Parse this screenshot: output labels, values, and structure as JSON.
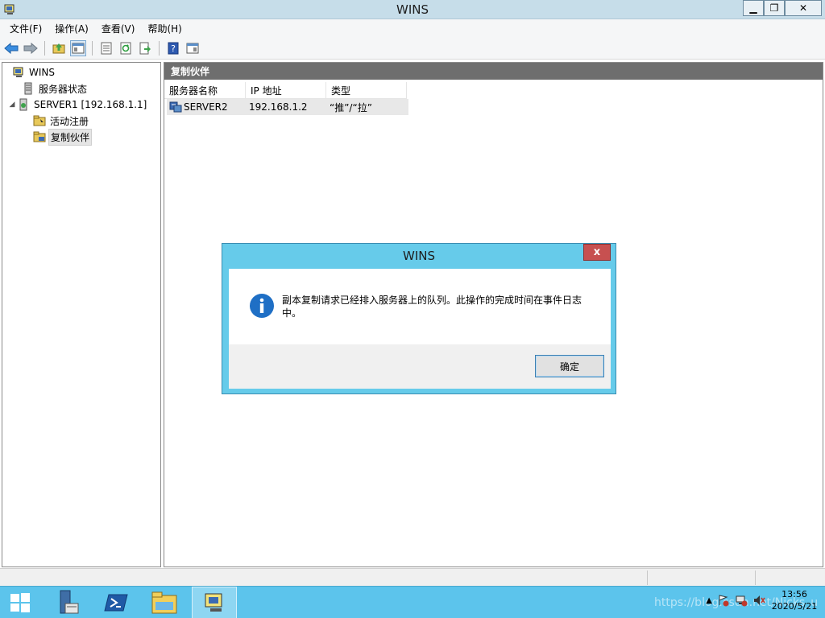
{
  "window": {
    "title": "WINS",
    "min_glyph": "▁",
    "max_glyph": "❐",
    "close_glyph": "✕"
  },
  "menu": [
    "文件(F)",
    "操作(A)",
    "查看(V)",
    "帮助(H)"
  ],
  "toolbar": {
    "icons": [
      "back-arrow-icon",
      "forward-arrow-icon",
      "up-folder-icon",
      "show-hide-console-tree-icon",
      "properties-icon",
      "refresh-icon",
      "export-list-icon",
      "help-icon",
      "show-hide-action-pane-icon"
    ]
  },
  "tree": {
    "root": "WINS",
    "server_status": "服务器状态",
    "server": "SERVER1 [192.168.1.1]",
    "expander": "◢",
    "active_registrations": "活动注册",
    "replication_partners": "复制伙伴"
  },
  "right_pane": {
    "header": "复制伙伴",
    "columns": [
      "服务器名称",
      "IP 地址",
      "类型"
    ],
    "rows": [
      {
        "name": "SERVER2",
        "ip": "192.168.1.2",
        "type": "“推”/“拉”"
      }
    ]
  },
  "dialog": {
    "title": "WINS",
    "close_glyph": "x",
    "message_line1": "副本复制请求已经排入服务器上的队列。此操作的完成时间在事件日志",
    "message_line2": "中。",
    "ok_label": "确定"
  },
  "taskbar": {
    "time": "13:56",
    "date": "2020/5/21",
    "watermark": "https://blog.csdn.net/Nicks_u"
  },
  "colors": {
    "taskbar": "#5cc4ec",
    "dialog_frame": "#66cbea",
    "pane_header": "#6e6e6e",
    "close_red": "#c75050"
  }
}
